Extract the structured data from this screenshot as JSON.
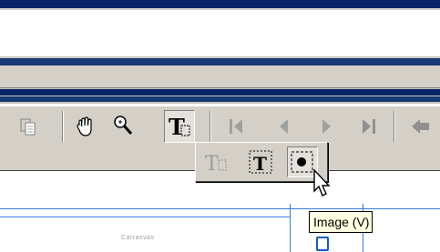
{
  "colors": {
    "titlebar": "#0a246a",
    "toolbar": "#d4d0c8",
    "tooltip_bg": "#ffffe1",
    "guide_line": "#3a7be0"
  },
  "toolbar": {
    "buttons": [
      {
        "icon": "paste-icon"
      },
      {
        "icon": "hand-tool-icon"
      },
      {
        "icon": "zoom-tool-icon"
      },
      {
        "icon": "text-select-tool-icon",
        "pressed": true
      },
      {
        "icon": "first-page-icon",
        "disabled": true
      },
      {
        "icon": "previous-page-icon",
        "disabled": true
      },
      {
        "icon": "next-page-icon",
        "disabled": true
      },
      {
        "icon": "last-page-icon",
        "disabled": true
      },
      {
        "icon": "go-back-icon"
      }
    ]
  },
  "flyout": {
    "tools": [
      {
        "icon": "text-select-icon"
      },
      {
        "icon": "column-select-icon"
      },
      {
        "icon": "image-select-icon",
        "hovered": true
      }
    ]
  },
  "tooltip": {
    "text": "Image (V)"
  },
  "document": {
    "caption_text": "Carrasvas"
  }
}
